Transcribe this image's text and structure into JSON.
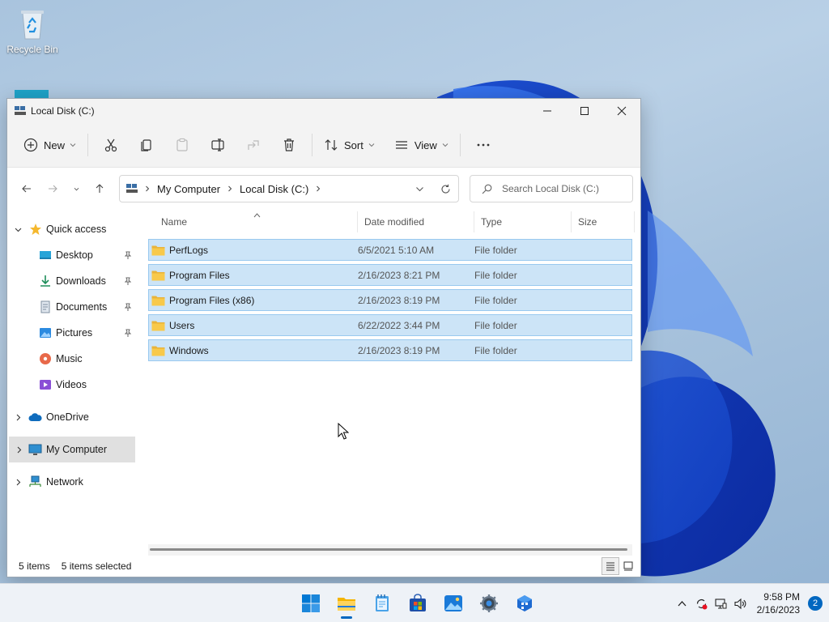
{
  "desktop": {
    "icons": [
      {
        "label": "Recycle Bin",
        "icon": "recycle-bin-icon"
      }
    ]
  },
  "window": {
    "title": "Local Disk (C:)",
    "controls": {
      "minimize": "minimize-icon",
      "maximize": "maximize-icon",
      "close": "close-icon"
    }
  },
  "toolbar": {
    "new_label": "New",
    "sort_label": "Sort",
    "view_label": "View",
    "icons": [
      "cut-icon",
      "copy-icon",
      "paste-icon",
      "rename-icon",
      "share-icon",
      "delete-icon",
      "more-icon"
    ]
  },
  "address": {
    "breadcrumbs": [
      "My Computer",
      "Local Disk (C:)"
    ],
    "search_placeholder": "Search Local Disk (C:)"
  },
  "navpane": {
    "quick_access": "Quick access",
    "items": [
      {
        "label": "Desktop",
        "icon": "desktop-icon",
        "pinned": true
      },
      {
        "label": "Downloads",
        "icon": "downloads-icon",
        "pinned": true
      },
      {
        "label": "Documents",
        "icon": "documents-icon",
        "pinned": true
      },
      {
        "label": "Pictures",
        "icon": "pictures-icon",
        "pinned": true
      },
      {
        "label": "Music",
        "icon": "music-icon",
        "pinned": false
      },
      {
        "label": "Videos",
        "icon": "videos-icon",
        "pinned": false
      }
    ],
    "onedrive": "OneDrive",
    "mycomputer": "My Computer",
    "network": "Network"
  },
  "files": {
    "columns": [
      "Name",
      "Date modified",
      "Type",
      "Size"
    ],
    "rows": [
      {
        "name": "PerfLogs",
        "date": "6/5/2021 5:10 AM",
        "type": "File folder",
        "size": ""
      },
      {
        "name": "Program Files",
        "date": "2/16/2023 8:21 PM",
        "type": "File folder",
        "size": ""
      },
      {
        "name": "Program Files (x86)",
        "date": "2/16/2023 8:19 PM",
        "type": "File folder",
        "size": ""
      },
      {
        "name": "Users",
        "date": "6/22/2022 3:44 PM",
        "type": "File folder",
        "size": ""
      },
      {
        "name": "Windows",
        "date": "2/16/2023 8:19 PM",
        "type": "File folder",
        "size": ""
      }
    ]
  },
  "status": {
    "count": "5 items",
    "selected": "5 items selected"
  },
  "taskbar": {
    "apps": [
      "start-icon",
      "file-explorer-icon",
      "notepad-icon",
      "store-icon",
      "photos-icon",
      "settings-icon",
      "app-icon"
    ],
    "time": "9:58 PM",
    "date": "2/16/2023",
    "notifications": "2"
  },
  "colors": {
    "selection_bg": "#cce4f7",
    "selection_border": "#99c9ef",
    "accent": "#0067c0",
    "folder": "#f8c94a"
  }
}
